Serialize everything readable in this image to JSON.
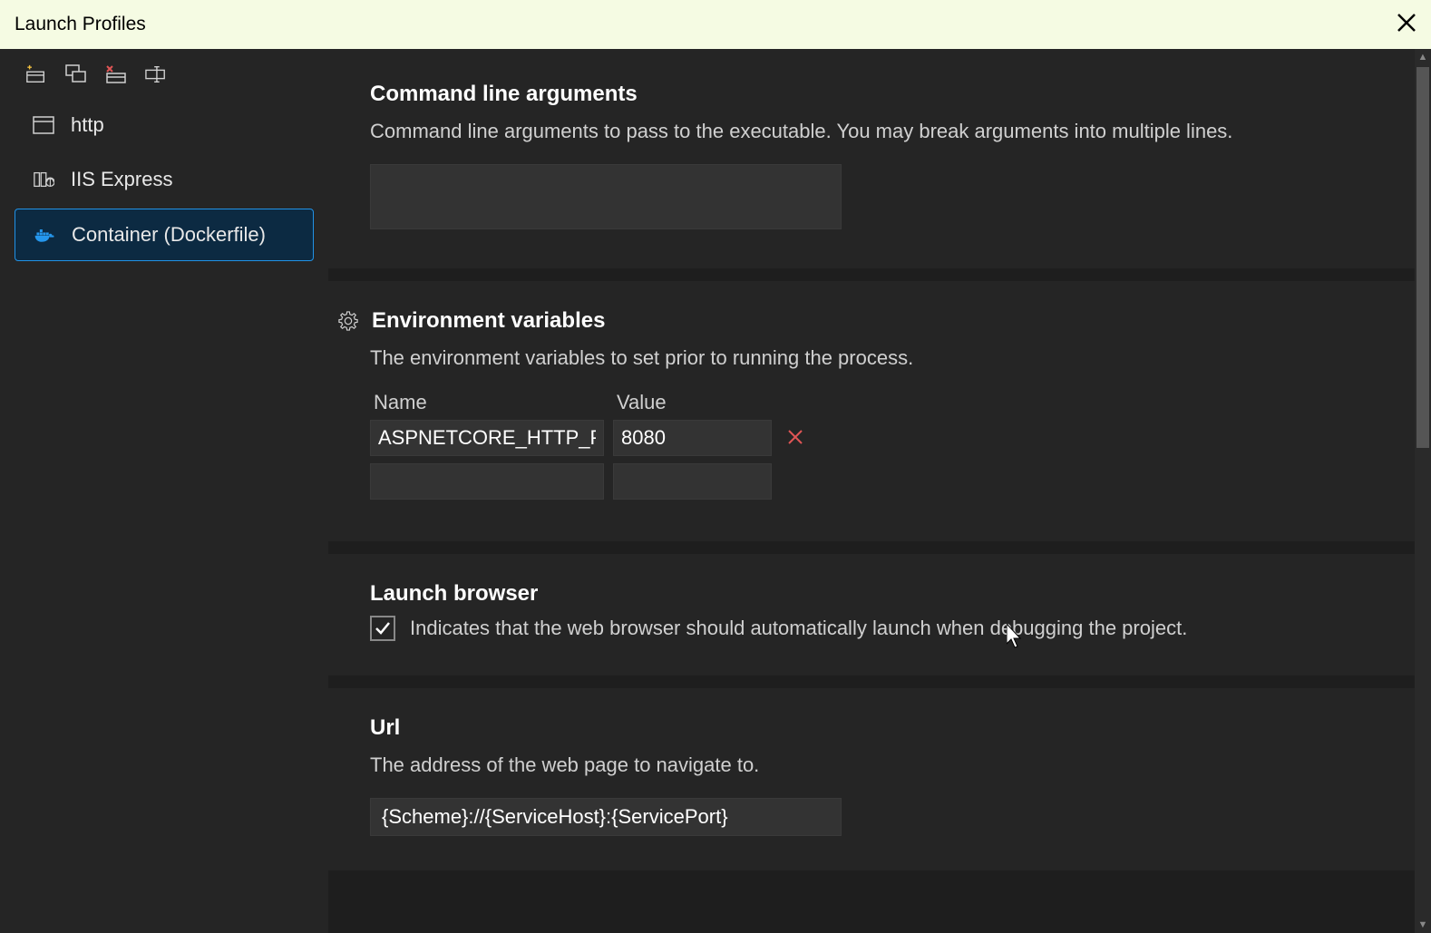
{
  "title": "Launch Profiles",
  "profiles": [
    {
      "label": "http"
    },
    {
      "label": "IIS Express"
    },
    {
      "label": "Container (Dockerfile)"
    }
  ],
  "sections": {
    "cmdargs": {
      "title": "Command line arguments",
      "desc": "Command line arguments to pass to the executable. You may break arguments into multiple lines.",
      "value": ""
    },
    "envvars": {
      "title": "Environment variables",
      "desc": "The environment variables to set prior to running the process.",
      "headers": {
        "name": "Name",
        "value": "Value"
      },
      "rows": [
        {
          "name": "ASPNETCORE_HTTP_PORTS",
          "value": "8080"
        }
      ]
    },
    "launchbrowser": {
      "title": "Launch browser",
      "label": "Indicates that the web browser should automatically launch when debugging the project.",
      "checked": true
    },
    "url": {
      "title": "Url",
      "desc": "The address of the web page to navigate to.",
      "value": "{Scheme}://{ServiceHost}:{ServicePort}"
    }
  }
}
